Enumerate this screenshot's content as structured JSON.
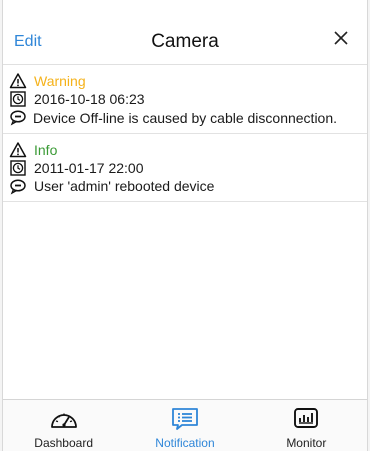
{
  "header": {
    "edit_label": "Edit",
    "title": "Camera"
  },
  "notifications": [
    {
      "level": "Warning",
      "timestamp": "2016-10-18 06:23",
      "message": "Device Off-line is caused by cable disconnection."
    },
    {
      "level": "Info",
      "timestamp": "2011-01-17 22:00",
      "message": "User 'admin' rebooted device"
    }
  ],
  "tabs": [
    {
      "label": "Dashboard",
      "icon": "speedometer-icon",
      "active": false
    },
    {
      "label": "Notification",
      "icon": "notification-list-icon",
      "active": true
    },
    {
      "label": "Monitor",
      "icon": "monitor-chart-icon",
      "active": false
    }
  ],
  "colors": {
    "accent": "#2f86d8",
    "warning": "#f5b21a",
    "info": "#3a9a35"
  }
}
